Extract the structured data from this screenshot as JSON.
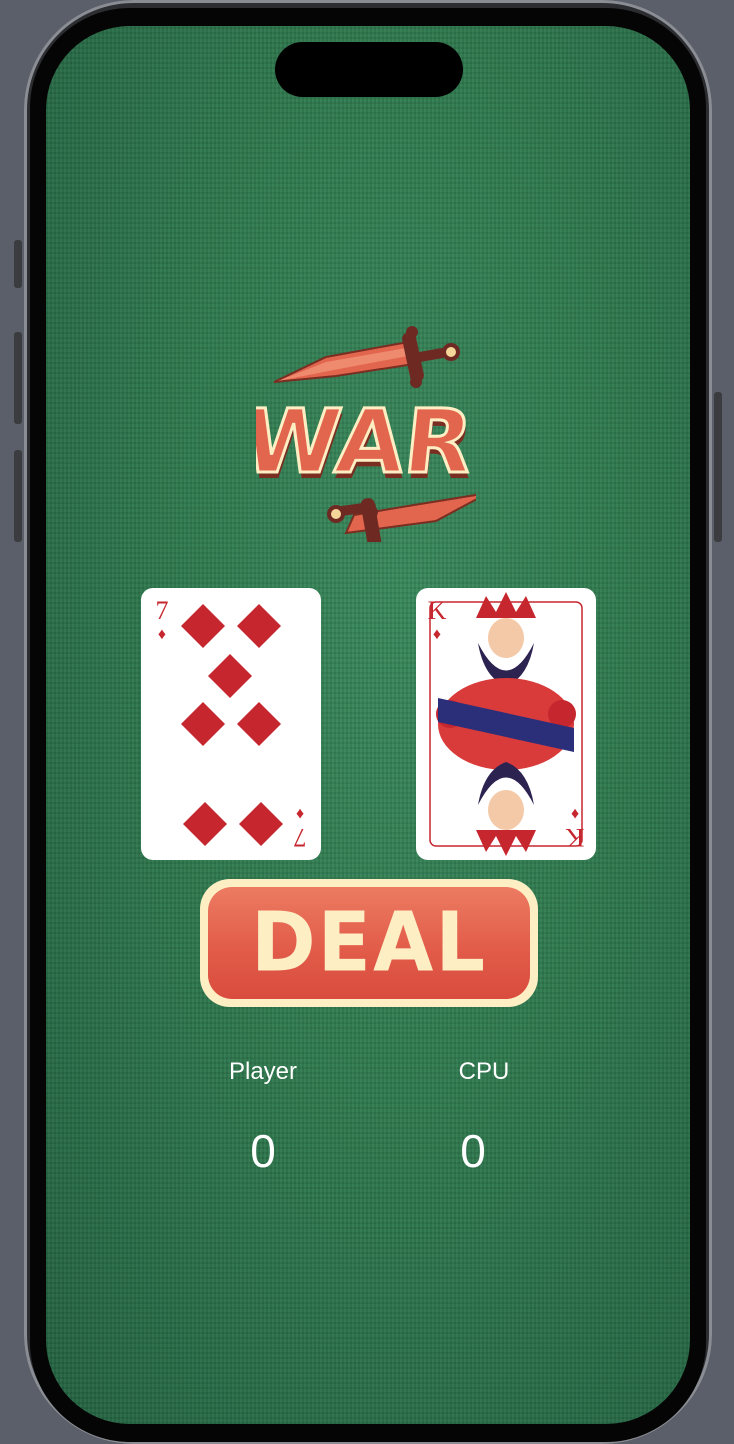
{
  "app": {
    "title": "WAR"
  },
  "cards": {
    "player": {
      "rank": "7",
      "suit": "♦",
      "color": "#c6262e"
    },
    "cpu": {
      "rank": "K",
      "suit": "♦",
      "color": "#c6262e"
    }
  },
  "deal_button": {
    "label": "DEAL"
  },
  "scores": {
    "player": {
      "label": "Player",
      "value": "0"
    },
    "cpu": {
      "label": "CPU",
      "value": "0"
    }
  },
  "colors": {
    "felt": "#2f7a4f",
    "accent": "#e15a48",
    "cream": "#fdeec4"
  }
}
